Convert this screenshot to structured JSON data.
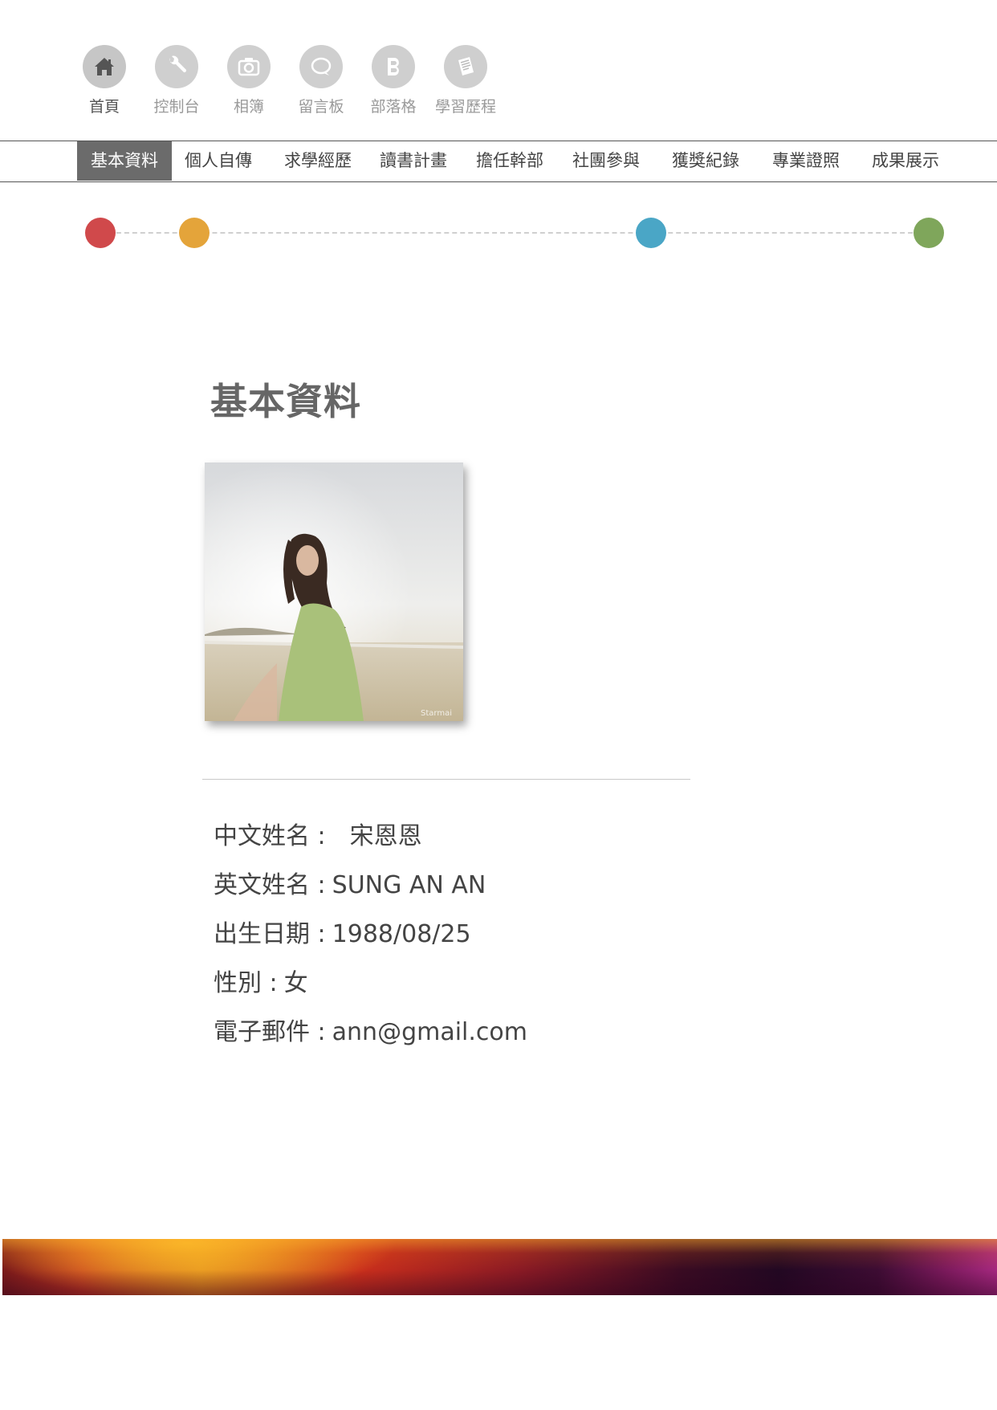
{
  "top_nav": {
    "items": [
      {
        "label": "首頁",
        "icon": "home-icon",
        "active": true
      },
      {
        "label": "控制台",
        "icon": "wrench-icon",
        "active": false
      },
      {
        "label": "相簿",
        "icon": "camera-icon",
        "active": false
      },
      {
        "label": "留言板",
        "icon": "speech-bubble-icon",
        "active": false
      },
      {
        "label": "部落格",
        "icon": "blog-b-icon",
        "active": false
      },
      {
        "label": "學習歷程",
        "icon": "document-icon",
        "active": false
      }
    ]
  },
  "tabs": [
    {
      "label": "基本資料",
      "active": true
    },
    {
      "label": "個人自傳"
    },
    {
      "label": "求學經歷"
    },
    {
      "label": "讀書計畫"
    },
    {
      "label": "擔任幹部"
    },
    {
      "label": "社團參與"
    },
    {
      "label": "獲獎紀錄"
    },
    {
      "label": "專業證照"
    },
    {
      "label": "成果展示"
    }
  ],
  "timeline": {
    "dots": [
      {
        "color": "#d0494b"
      },
      {
        "color": "#e4a43a"
      },
      {
        "color": "#4aa6c6"
      },
      {
        "color": "#7fa65b"
      }
    ]
  },
  "main": {
    "title": "基本資料",
    "photo_watermark": "Starmai",
    "fields": [
      {
        "label": "中文姓名 :",
        "value": "宋恩恩"
      },
      {
        "label": "英文姓名 :",
        "value": "SUNG AN AN"
      },
      {
        "label": "出生日期 :",
        "value": "1988/08/25"
      },
      {
        "label": "性別 :",
        "value": "女"
      },
      {
        "label": "電子郵件 :",
        "value": "ann@gmail.com"
      }
    ]
  },
  "colors": {
    "tab_active_bg": "#6b6b6b",
    "icon_circle": "#cfcfcf",
    "footer_gradient": [
      "#e07a1a",
      "#8a1a24",
      "#220822",
      "#a5287f"
    ]
  }
}
